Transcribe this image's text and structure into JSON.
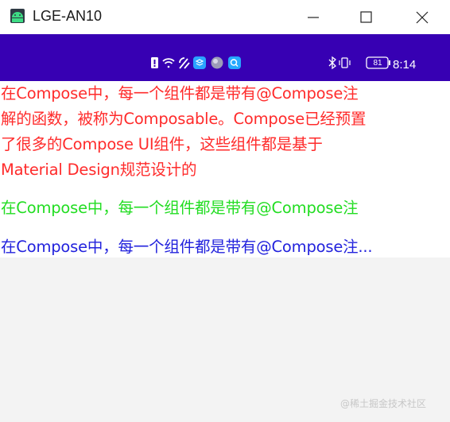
{
  "window": {
    "title": "LGE-AN10",
    "minimize_icon": "minimize-icon",
    "maximize_icon": "maximize-icon",
    "close_icon": "close-icon"
  },
  "status_bar": {
    "color": "#3700b3",
    "left_icons": [
      "notification-icon",
      "wifi-icon",
      "signal-icon",
      "app-icon",
      "dot-icon",
      "message-icon"
    ],
    "right_icons": [
      "bluetooth-icon",
      "vibrate-icon",
      "battery-icon"
    ],
    "battery": "81",
    "time": "8:14"
  },
  "content": {
    "red_text_lines": [
      "在Compose中，每一个组件都是带有@Compose注",
      "解的函数，被称为Composable。Compose已经预置",
      "了很多的Compose UI组件，这些组件都是基于",
      "Material Design规范设计的"
    ],
    "green_text": "在Compose中，每一个组件都是带有@Compose注",
    "blue_text": "在Compose中，每一个组件都是带有@Compose注...",
    "colors": {
      "red": "#ff2b2b",
      "green": "#22dd22",
      "blue": "#2222dd"
    }
  },
  "watermark": "@稀土掘金技术社区"
}
